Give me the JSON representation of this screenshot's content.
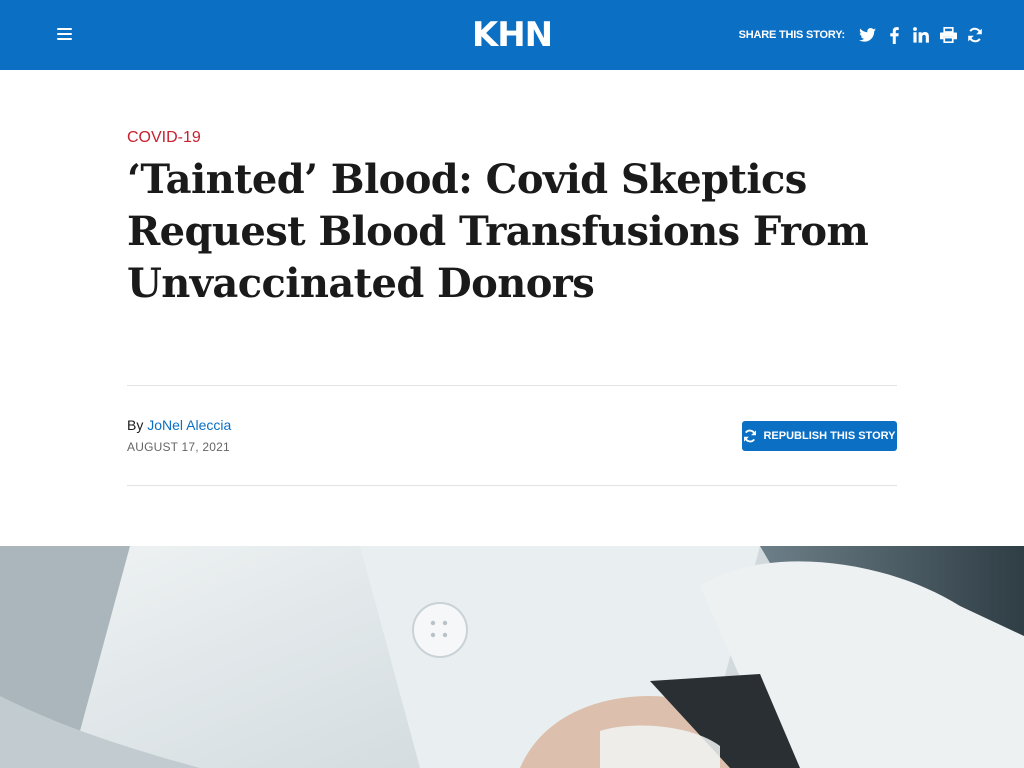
{
  "header": {
    "logo_text": "KHN",
    "share_label": "SHARE THIS STORY:",
    "share_icons": [
      "twitter-icon",
      "facebook-icon",
      "linkedin-icon",
      "print-icon",
      "republish-icon"
    ],
    "brand_color": "#0b6fc4"
  },
  "article": {
    "category": "COVID-19",
    "category_color": "#c8202f",
    "title": "‘Tainted’ Blood: Covid Skeptics Request Blood Transfusions From Unvaccinated Donors",
    "byline_prefix": "By",
    "author": "JoNel Aleccia",
    "date": "AUGUST 17, 2021",
    "republish_label": "REPUBLISH THIS STORY"
  }
}
